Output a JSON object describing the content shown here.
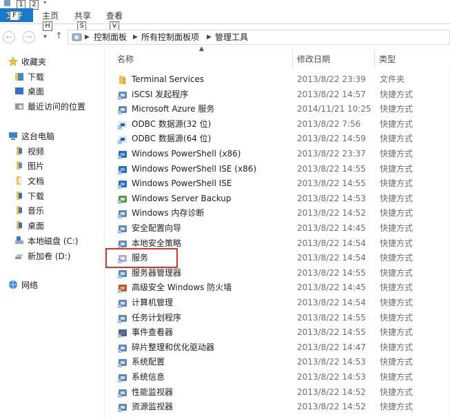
{
  "ribbon": {
    "quick_access": [
      "1",
      "2"
    ],
    "tabs": [
      {
        "label": "文件",
        "keytip": "F"
      },
      {
        "label": "主页",
        "keytip": "H"
      },
      {
        "label": "共享",
        "keytip": "S"
      },
      {
        "label": "查看",
        "keytip": "V"
      }
    ]
  },
  "breadcrumb": [
    "控制面板",
    "所有控制面板项",
    "管理工具"
  ],
  "nav": {
    "favorites": {
      "label": "收藏夹",
      "items": [
        "下载",
        "桌面",
        "最近访问的位置"
      ]
    },
    "this_pc": {
      "label": "这台电脑",
      "items": [
        "视频",
        "图片",
        "文档",
        "下载",
        "音乐",
        "桌面",
        "本地磁盘 (C:)",
        "新加卷 (D:)"
      ]
    },
    "network": {
      "label": "网络"
    }
  },
  "columns": {
    "name": "名称",
    "date": "修改日期",
    "type": "类型"
  },
  "files": [
    {
      "name": "Terminal Services",
      "date": "2013/8/22 23:39",
      "type": "文件夹",
      "icon": "folder-icon"
    },
    {
      "name": "iSCSI 发起程序",
      "date": "2013/8/22 14:57",
      "type": "快捷方式",
      "icon": "iscsi-icon"
    },
    {
      "name": "Microsoft Azure 服务",
      "date": "2014/11/21 10:25",
      "type": "快捷方式",
      "icon": "azure-icon"
    },
    {
      "name": "ODBC 数据源(32 位)",
      "date": "2013/8/22 7:56",
      "type": "快捷方式",
      "icon": "odbc-icon"
    },
    {
      "name": "ODBC 数据源(64 位)",
      "date": "2013/8/22 14:59",
      "type": "快捷方式",
      "icon": "odbc-icon"
    },
    {
      "name": "Windows PowerShell (x86)",
      "date": "2013/8/22 23:37",
      "type": "快捷方式",
      "icon": "powershell-icon"
    },
    {
      "name": "Windows PowerShell ISE (x86)",
      "date": "2013/8/22 14:55",
      "type": "快捷方式",
      "icon": "powershell-icon"
    },
    {
      "name": "Windows PowerShell ISE",
      "date": "2013/8/22 14:55",
      "type": "快捷方式",
      "icon": "powershell-icon"
    },
    {
      "name": "Windows Server Backup",
      "date": "2013/8/22 14:53",
      "type": "快捷方式",
      "icon": "backup-icon"
    },
    {
      "name": "Windows 内存诊断",
      "date": "2013/8/22 14:52",
      "type": "快捷方式",
      "icon": "memory-icon"
    },
    {
      "name": "安全配置向导",
      "date": "2013/8/22 14:45",
      "type": "快捷方式",
      "icon": "security-wizard-icon"
    },
    {
      "name": "本地安全策略",
      "date": "2013/8/22 14:54",
      "type": "快捷方式",
      "icon": "security-policy-icon"
    },
    {
      "name": "服务",
      "date": "2013/8/22 14:54",
      "type": "快捷方式",
      "icon": "services-icon"
    },
    {
      "name": "服务器管理器",
      "date": "2013/8/22 14:55",
      "type": "快捷方式",
      "icon": "server-manager-icon"
    },
    {
      "name": "高级安全 Windows 防火墙",
      "date": "2013/8/22 14:45",
      "type": "快捷方式",
      "icon": "firewall-icon"
    },
    {
      "name": "计算机管理",
      "date": "2013/8/22 14:54",
      "type": "快捷方式",
      "icon": "computer-management-icon"
    },
    {
      "name": "任务计划程序",
      "date": "2013/8/22 14:55",
      "type": "快捷方式",
      "icon": "task-scheduler-icon"
    },
    {
      "name": "事件查看器",
      "date": "2013/8/22 14:55",
      "type": "快捷方式",
      "icon": "event-viewer-icon"
    },
    {
      "name": "碎片整理和优化驱动器",
      "date": "2013/8/22 14:47",
      "type": "快捷方式",
      "icon": "defrag-icon"
    },
    {
      "name": "系统配置",
      "date": "2013/8/22 14:53",
      "type": "快捷方式",
      "icon": "system-config-icon"
    },
    {
      "name": "系统信息",
      "date": "2013/8/22 14:53",
      "type": "快捷方式",
      "icon": "system-info-icon"
    },
    {
      "name": "性能监视器",
      "date": "2013/8/22 14:52",
      "type": "快捷方式",
      "icon": "performance-monitor-icon"
    },
    {
      "name": "资源监视器",
      "date": "2013/8/22 14:52",
      "type": "快捷方式",
      "icon": "resource-monitor-icon"
    }
  ],
  "colors": {
    "accent": "#1979ca",
    "highlight": "#e3302a",
    "folder": "#f0c24f"
  }
}
